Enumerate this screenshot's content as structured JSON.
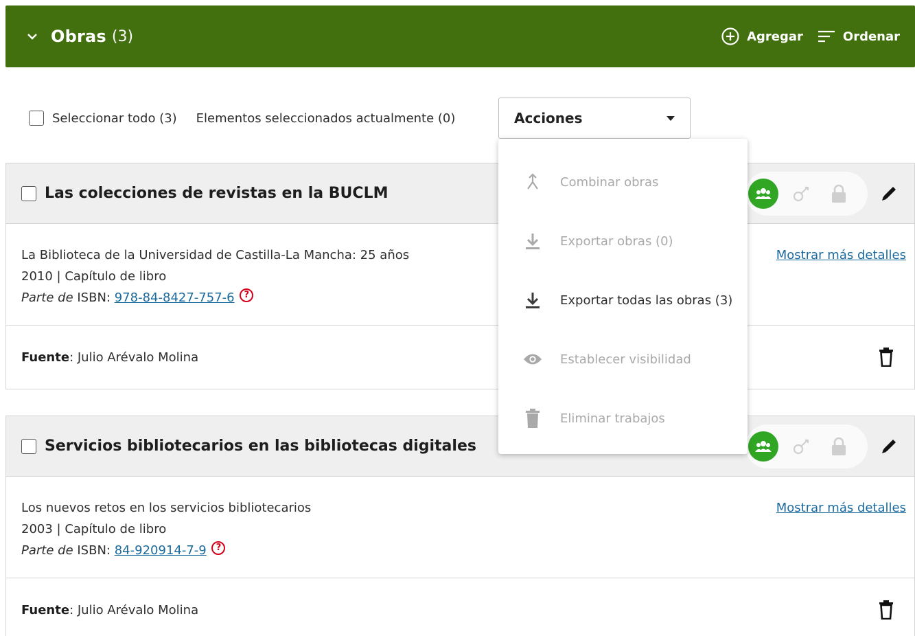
{
  "header": {
    "title": "Obras",
    "count": "(3)",
    "add_label": "Agregar",
    "sort_label": "Ordenar",
    "bg_color": "#42700e"
  },
  "toolbar": {
    "select_all_label": "Seleccionar todo (3)",
    "selected_label": "Elementos seleccionados actualmente (0)",
    "actions_label": "Acciones"
  },
  "actions_menu": {
    "items": [
      {
        "label": "Combinar obras",
        "icon": "merge-icon",
        "enabled": false
      },
      {
        "label": "Exportar obras (0)",
        "icon": "download-icon",
        "enabled": false
      },
      {
        "label": "Exportar todas las obras (3)",
        "icon": "download-icon",
        "enabled": true
      },
      {
        "label": "Establecer visibilidad",
        "icon": "eye-icon",
        "enabled": false
      },
      {
        "label": "Eliminar trabajos",
        "icon": "trash-icon",
        "enabled": false
      }
    ]
  },
  "works": [
    {
      "title": "Las colecciones de revistas en la BUCLM",
      "container": "La Biblioteca de la Universidad de Castilla-La Mancha: 25 años",
      "meta": "2010 | Capítulo de libro",
      "part_of": "Parte de",
      "isbn_label": "ISBN:",
      "isbn": "978-84-8427-757-6",
      "more_details": "Mostrar más detalles",
      "source_label": "Fuente",
      "source": ": Julio Arévalo Molina"
    },
    {
      "title": "Servicios bibliotecarios en las bibliotecas digitales",
      "container": "Los nuevos retos en los servicios bibliotecarios",
      "meta": "2003 | Capítulo de libro",
      "part_of": "Parte de",
      "isbn_label": "ISBN:",
      "isbn": "84-920914-7-9",
      "more_details": "Mostrar más detalles",
      "source_label": "Fuente",
      "source": ": Julio Arévalo Molina"
    }
  ],
  "colors": {
    "public_visibility": "#31a524",
    "link": "#1b6a9e",
    "doi_marker": "#d0021b"
  }
}
